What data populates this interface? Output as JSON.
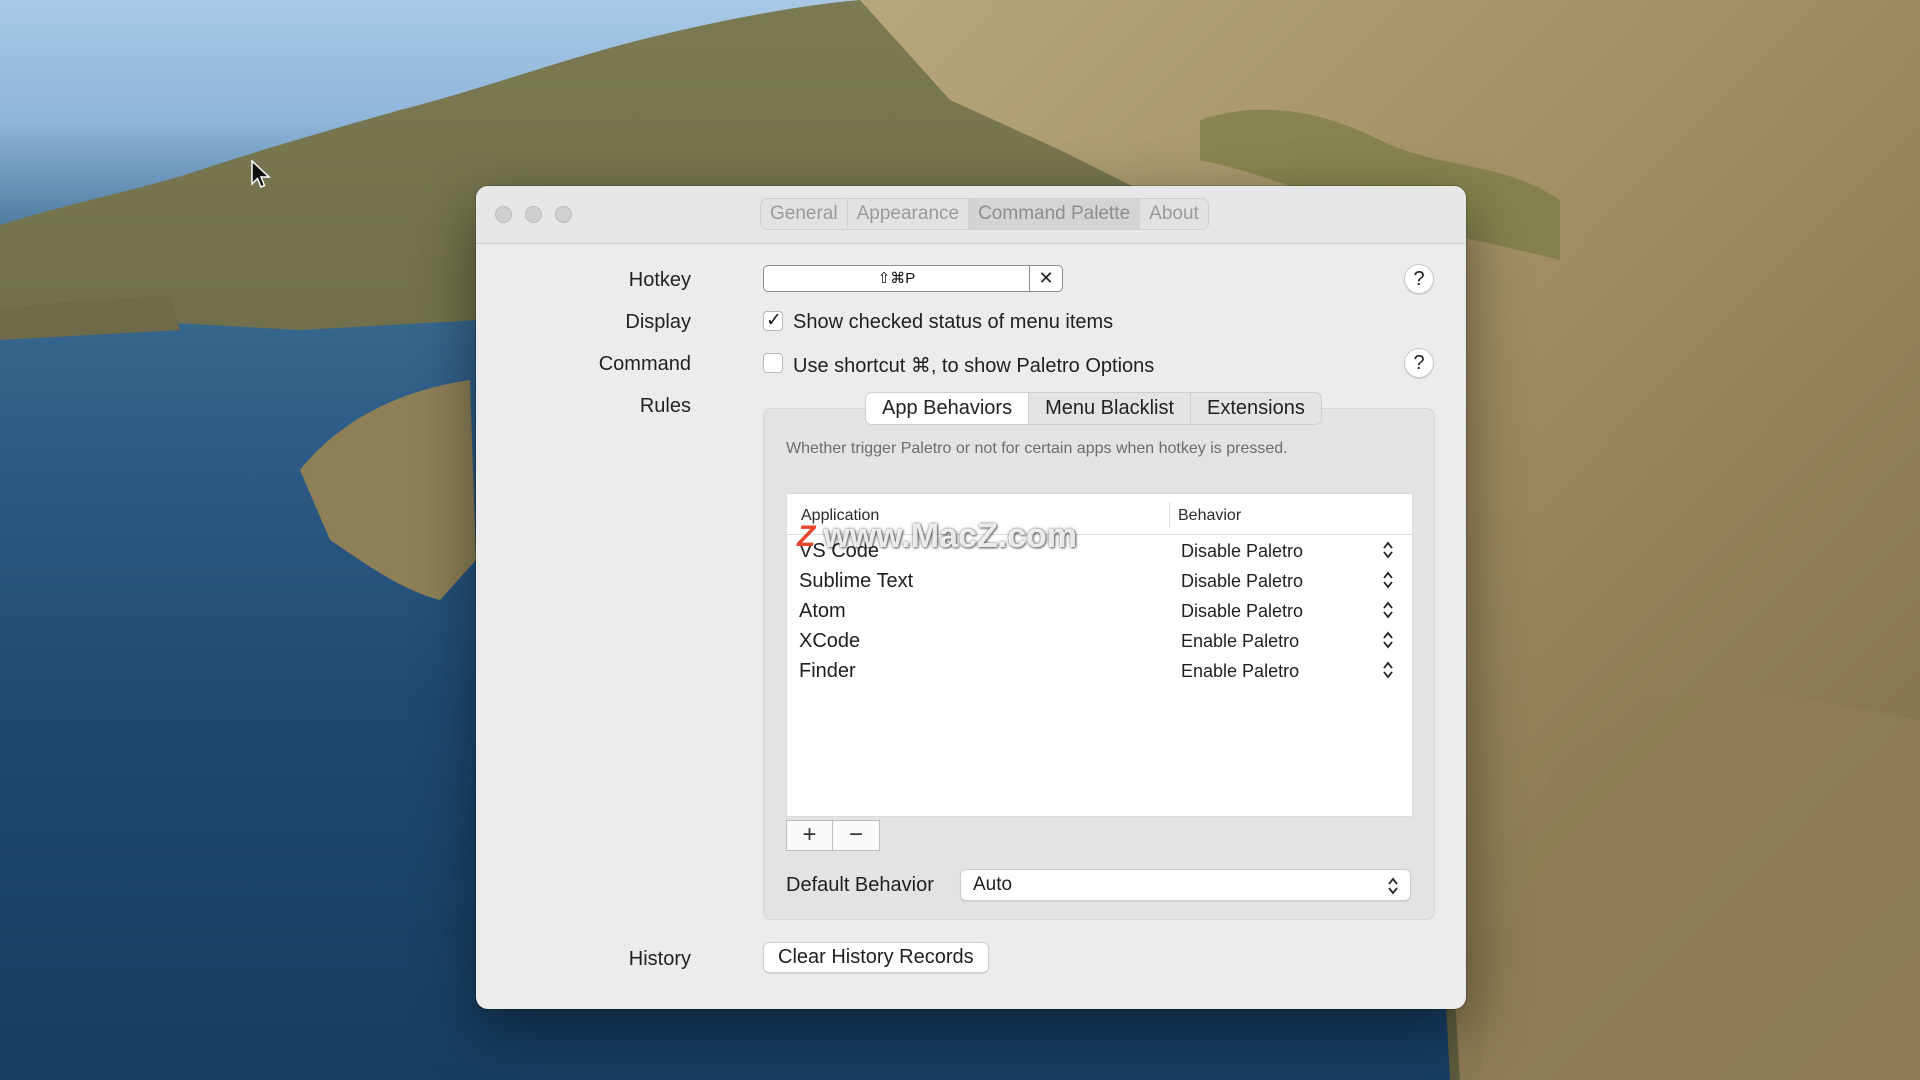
{
  "window": {
    "tabs": [
      {
        "label": "General",
        "active": false
      },
      {
        "label": "Appearance",
        "active": false
      },
      {
        "label": "Command Palette",
        "active": true
      },
      {
        "label": "About",
        "active": false
      }
    ]
  },
  "settings": {
    "hotkey_label": "Hotkey",
    "hotkey_value": "⇧⌘P",
    "hotkey_clear": "✕",
    "display_label": "Display",
    "display_checkbox": {
      "label": "Show checked status of menu items",
      "checked": true
    },
    "command_label": "Command",
    "command_checkbox": {
      "label": "Use shortcut ⌘, to show Paletro Options",
      "checked": false
    },
    "rules_label": "Rules",
    "history_label": "History",
    "clear_history": "Clear History Records",
    "help": "?"
  },
  "rules": {
    "tabs": [
      {
        "label": "App Behaviors",
        "active": true
      },
      {
        "label": "Menu Blacklist",
        "active": false
      },
      {
        "label": "Extensions",
        "active": false
      }
    ],
    "description": "Whether trigger Paletro or not for certain apps when hotkey is pressed.",
    "table": {
      "columns": [
        "Application",
        "Behavior"
      ],
      "rows": [
        {
          "app": "VS Code",
          "behavior": "Disable Paletro"
        },
        {
          "app": "Sublime Text",
          "behavior": "Disable Paletro"
        },
        {
          "app": "Atom",
          "behavior": "Disable Paletro"
        },
        {
          "app": "XCode",
          "behavior": "Enable Paletro"
        },
        {
          "app": "Finder",
          "behavior": "Enable Paletro"
        }
      ]
    },
    "add": "+",
    "remove": "−",
    "default_behavior_label": "Default Behavior",
    "default_behavior_value": "Auto"
  },
  "watermark": {
    "logo": "Z",
    "text": "www.MacZ.com"
  }
}
